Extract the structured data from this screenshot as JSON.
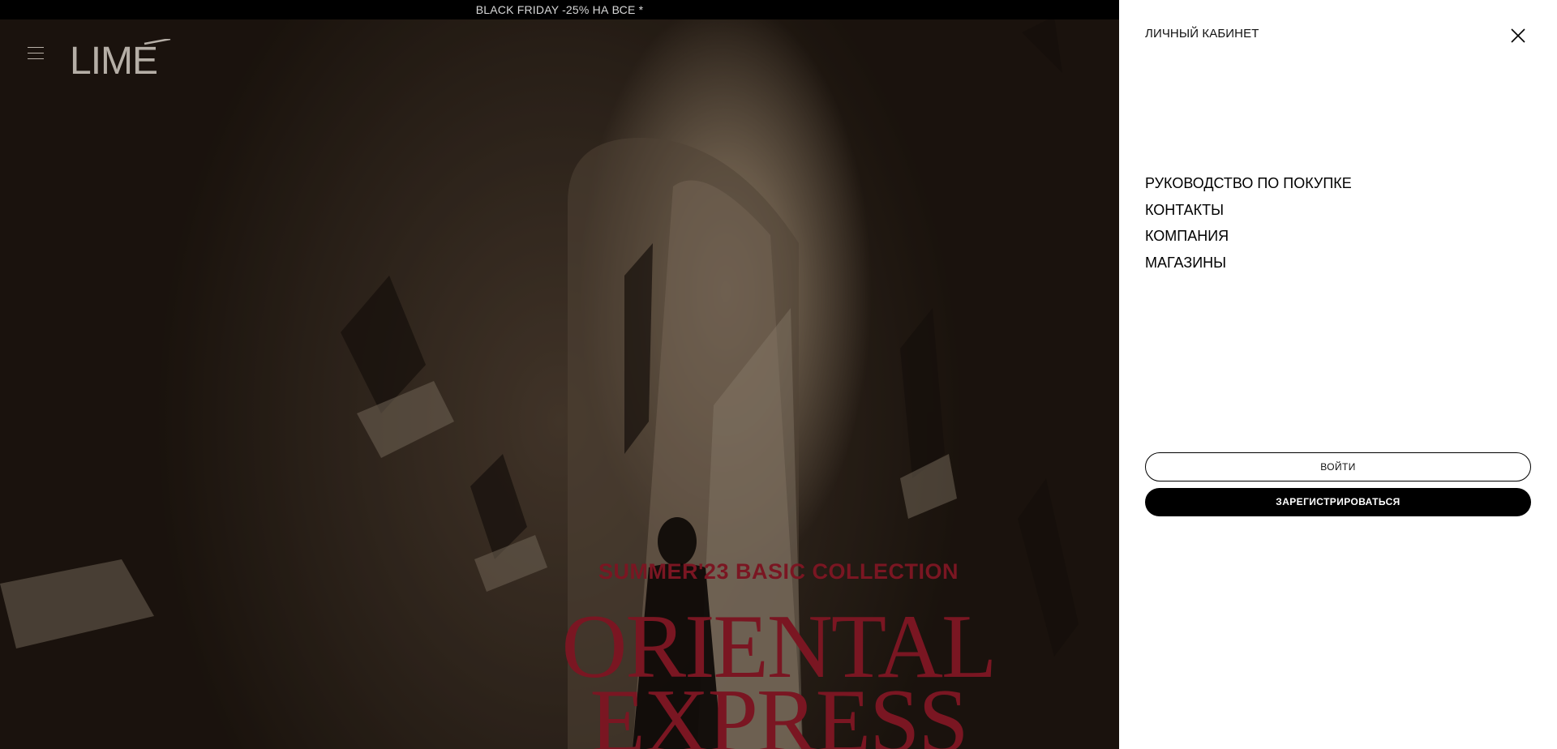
{
  "announcement": {
    "text": "BLACK FRIDAY -25% НА ВСЕ *"
  },
  "header": {
    "logo_text": "LIME",
    "menu_icon": "hamburger-icon"
  },
  "hero": {
    "subtitle": "SUMMER'23 BASIC COLLECTION",
    "title_line1": "ORIENTAL",
    "title_line2": "EXPRESS",
    "accent_color": "#7a1622"
  },
  "account_panel": {
    "title": "ЛИЧНЫЙ КАБИНЕТ",
    "close_icon": "close-icon",
    "menu_items": [
      {
        "label": "РУКОВОДСТВО ПО ПОКУПКЕ"
      },
      {
        "label": "КОНТАКТЫ"
      },
      {
        "label": "КОМПАНИЯ"
      },
      {
        "label": "МАГАЗИНЫ"
      }
    ],
    "login_label": "ВОЙТИ",
    "register_label": "ЗАРЕГИСТРИРОВАТЬСЯ"
  }
}
